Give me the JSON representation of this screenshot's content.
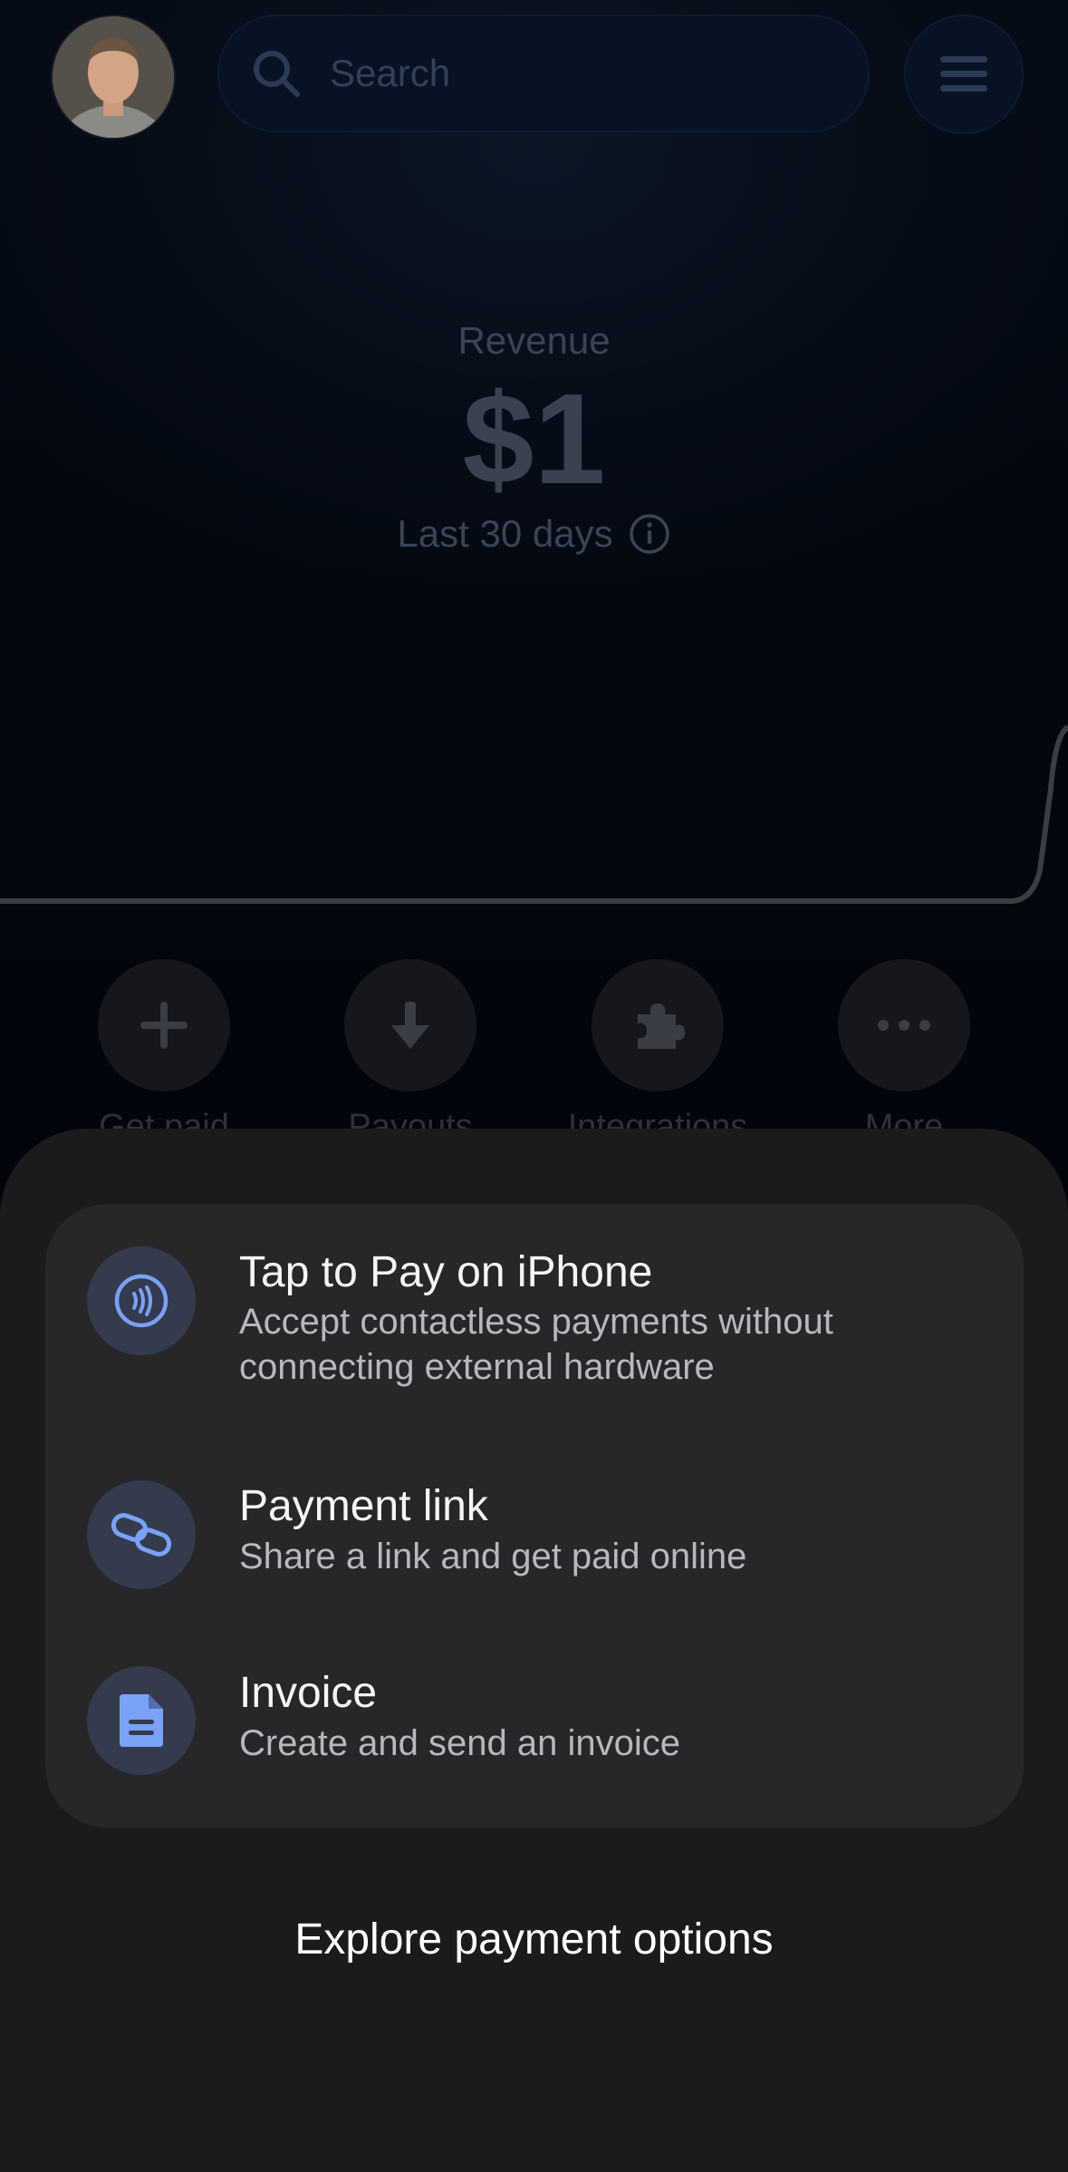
{
  "header": {
    "search_placeholder": "Search",
    "profile_icon": "avatar",
    "search_icon": "search-icon",
    "menu_icon": "hamburger-icon"
  },
  "summary": {
    "label": "Revenue",
    "value": "$1",
    "period": "Last 30 days",
    "info_icon": "info-icon"
  },
  "quick_actions": [
    {
      "label": "Get paid",
      "icon": "plus-icon"
    },
    {
      "label": "Payouts",
      "icon": "arrow-down-icon"
    },
    {
      "label": "Integrations",
      "icon": "puzzle-icon"
    },
    {
      "label": "More",
      "icon": "more-icon"
    }
  ],
  "sheet": {
    "options": [
      {
        "title": "Tap to Pay on iPhone",
        "description": "Accept contactless payments without connecting external hardware",
        "icon": "contactless-icon"
      },
      {
        "title": "Payment link",
        "description": "Share a link and get paid online",
        "icon": "link-icon"
      },
      {
        "title": "Invoice",
        "description": "Create and send an invoice",
        "icon": "document-icon"
      }
    ],
    "explore_label": "Explore payment options"
  },
  "colors": {
    "accent": "#7aa2f7",
    "sheet_bg": "#1b1b1d",
    "card_bg": "#27272a"
  }
}
